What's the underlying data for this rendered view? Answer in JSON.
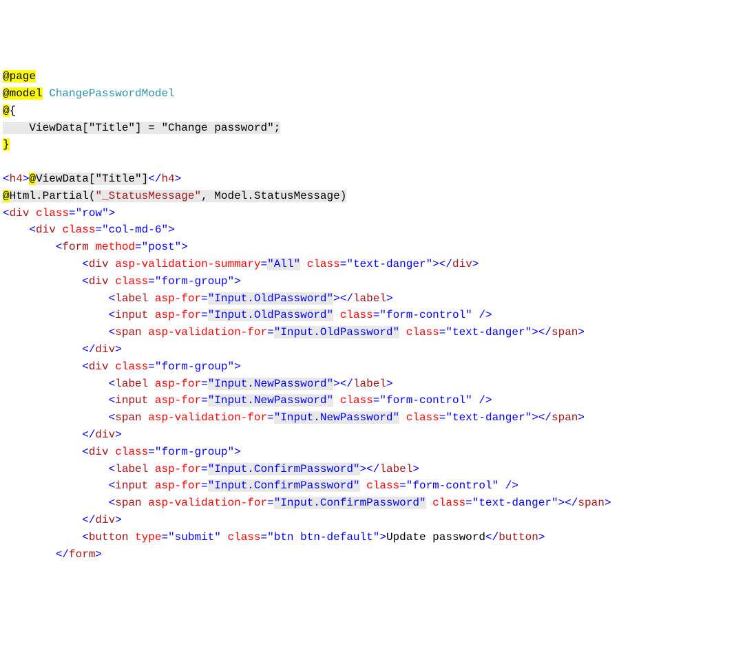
{
  "l1_page": "@page",
  "l2_model": "@model",
  "l2_type": "ChangePasswordModel",
  "l3_at": "@",
  "l3_brace": "{",
  "l4_expr": "    ViewData[\"Title\"] = \"Change password\";",
  "l5_brace": "}",
  "l6_open_lt": "<",
  "l6_tag": "h4",
  "l6_gt": ">",
  "l6_at": "@",
  "l6_expr": "ViewData[\"Title\"]",
  "l6_close_lt": "</",
  "l6_close_gt": ">",
  "l7_at": "@",
  "l7_expr_a": "Html.Partial(",
  "l7_str": "\"_StatusMessage\"",
  "l7_expr_b": ", Model.StatusMessage)",
  "l8_lt": "<",
  "l8_tag": "div",
  "l8_attr": "class",
  "l8_eq": "=",
  "l8_val": "\"row\"",
  "l8_gt": ">",
  "l9_ind": "    ",
  "l9_lt": "<",
  "l9_tag": "div",
  "l9_attr": "class",
  "l9_eq": "=",
  "l9_val": "\"col-md-6\"",
  "l9_gt": ">",
  "l10_ind": "        ",
  "l10_lt": "<",
  "l10_tag": "form",
  "l10_attr": "method",
  "l10_eq": "=",
  "l10_val": "\"post\"",
  "l10_gt": ">",
  "l11_ind": "            ",
  "l11_lt": "<",
  "l11_tag": "div",
  "l11_a1": "asp-validation-summary",
  "l11_eq": "=",
  "l11_v1": "\"All\"",
  "l11_a2": "class",
  "l11_v2": "\"text-danger\"",
  "l11_gt": ">",
  "l11_clt": "</",
  "l11_cgt": ">",
  "l12_ind": "            ",
  "l12_lt": "<",
  "l12_tag": "div",
  "l12_a1": "class",
  "l12_eq": "=",
  "l12_v1": "\"form-group\"",
  "l12_gt": ">",
  "l13_ind": "                ",
  "l13_lt": "<",
  "l13_tag": "label",
  "l13_a1": "asp-for",
  "l13_eq": "=",
  "l13_v1": "\"Input.OldPassword\"",
  "l13_gt": ">",
  "l13_clt": "</",
  "l13_cgt": ">",
  "l14_ind": "                ",
  "l14_lt": "<",
  "l14_tag": "input",
  "l14_a1": "asp-for",
  "l14_eq": "=",
  "l14_v1": "\"Input.OldPassword\"",
  "l14_a2": "class",
  "l14_v2": "\"form-control\"",
  "l14_gt": " />",
  "l15_ind": "                ",
  "l15_lt": "<",
  "l15_tag": "span",
  "l15_a1": "asp-validation-for",
  "l15_eq": "=",
  "l15_v1": "\"Input.OldPassword\"",
  "l15_a2": "class",
  "l15_v2": "\"text-danger\"",
  "l15_gt": ">",
  "l15_clt": "</",
  "l15_cgt": ">",
  "l16_ind": "            ",
  "l16_clt": "</",
  "l16_tag": "div",
  "l16_cgt": ">",
  "l17_ind": "            ",
  "l17_lt": "<",
  "l17_tag": "div",
  "l17_a1": "class",
  "l17_eq": "=",
  "l17_v1": "\"form-group\"",
  "l17_gt": ">",
  "l18_ind": "                ",
  "l18_lt": "<",
  "l18_tag": "label",
  "l18_a1": "asp-for",
  "l18_eq": "=",
  "l18_v1": "\"Input.NewPassword\"",
  "l18_gt": ">",
  "l18_clt": "</",
  "l18_cgt": ">",
  "l19_ind": "                ",
  "l19_lt": "<",
  "l19_tag": "input",
  "l19_a1": "asp-for",
  "l19_eq": "=",
  "l19_v1": "\"Input.NewPassword\"",
  "l19_a2": "class",
  "l19_v2": "\"form-control\"",
  "l19_gt": " />",
  "l20_ind": "                ",
  "l20_lt": "<",
  "l20_tag": "span",
  "l20_a1": "asp-validation-for",
  "l20_eq": "=",
  "l20_v1": "\"Input.NewPassword\"",
  "l20_a2": "class",
  "l20_v2": "\"text-danger\"",
  "l20_gt": ">",
  "l20_clt": "</",
  "l20_cgt": ">",
  "l21_ind": "            ",
  "l21_clt": "</",
  "l21_tag": "div",
  "l21_cgt": ">",
  "l22_ind": "            ",
  "l22_lt": "<",
  "l22_tag": "div",
  "l22_a1": "class",
  "l22_eq": "=",
  "l22_v1": "\"form-group\"",
  "l22_gt": ">",
  "l23_ind": "                ",
  "l23_lt": "<",
  "l23_tag": "label",
  "l23_a1": "asp-for",
  "l23_eq": "=",
  "l23_v1": "\"Input.ConfirmPassword\"",
  "l23_gt": ">",
  "l23_clt": "</",
  "l23_cgt": ">",
  "l24_ind": "                ",
  "l24_lt": "<",
  "l24_tag": "input",
  "l24_a1": "asp-for",
  "l24_eq": "=",
  "l24_v1": "\"Input.ConfirmPassword\"",
  "l24_a2": "class",
  "l24_v2": "\"form-control\"",
  "l24_gt": " />",
  "l25_ind": "                ",
  "l25_lt": "<",
  "l25_tag": "span",
  "l25_a1": "asp-validation-for",
  "l25_eq": "=",
  "l25_v1": "\"Input.ConfirmPassword\"",
  "l25_a2": "class",
  "l25_v2": "\"text-danger\"",
  "l25_gt": ">",
  "l25_clt": "</",
  "l25_cgt": ">",
  "l26_ind": "            ",
  "l26_clt": "</",
  "l26_tag": "div",
  "l26_cgt": ">",
  "l27_ind": "            ",
  "l27_lt": "<",
  "l27_tag": "button",
  "l27_a1": "type",
  "l27_eq": "=",
  "l27_v1": "\"submit\"",
  "l27_a2": "class",
  "l27_v2": "\"btn btn-default\"",
  "l27_gt": ">",
  "l27_txt": "Update password",
  "l27_clt": "</",
  "l27_cgt": ">",
  "l28_ind": "        ",
  "l28_clt": "</",
  "l28_tag": "form",
  "l28_cgt": ">"
}
